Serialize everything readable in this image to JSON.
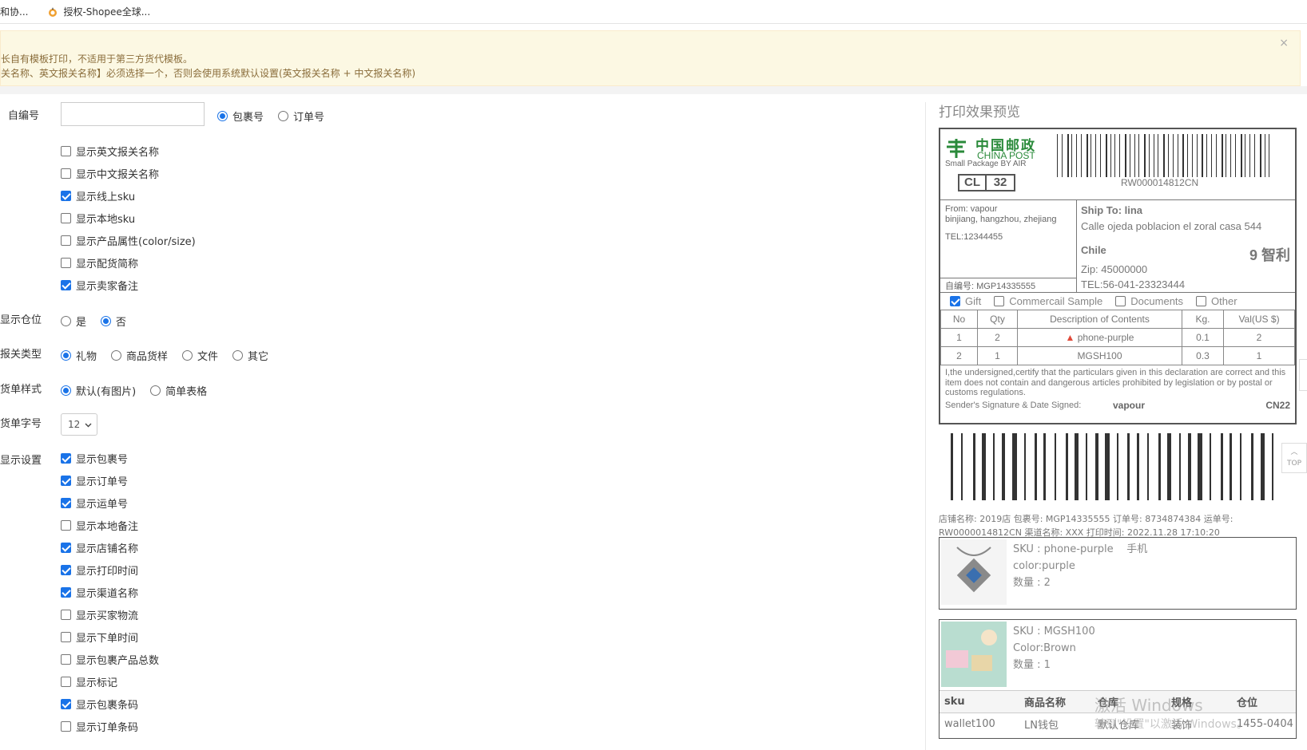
{
  "bookmarks": [
    {
      "label": "和协..."
    },
    {
      "label": "授权-Shopee全球..."
    }
  ],
  "notice": {
    "line1": "长自有模板打印，不适用于第三方货代模板。",
    "line2": "关名称、英文报关名称】必须选择一个，否则会使用系统默认设置(英文报关名称 + 中文报关名称)",
    "close": "×"
  },
  "form": {
    "custom_no_label": "自编号",
    "custom_no_value": "",
    "number_type": {
      "options": [
        "包裹号",
        "订单号"
      ],
      "selected": "包裹号"
    },
    "checks_top": [
      {
        "label": "显示英文报关名称",
        "checked": false
      },
      {
        "label": "显示中文报关名称",
        "checked": false
      },
      {
        "label": "显示线上sku",
        "checked": true
      },
      {
        "label": "显示本地sku",
        "checked": false
      },
      {
        "label": "显示产品属性(color/size)",
        "checked": false
      },
      {
        "label": "显示配货简称",
        "checked": false
      },
      {
        "label": "显示卖家备注",
        "checked": true
      }
    ],
    "show_location": {
      "label": "显示仓位",
      "options": [
        "是",
        "否"
      ],
      "selected": "否"
    },
    "declare_type": {
      "label": "报关类型",
      "options": [
        "礼物",
        "商品货样",
        "文件",
        "其它"
      ],
      "selected": "礼物"
    },
    "bill_style": {
      "label": "货单样式",
      "options": [
        "默认(有图片)",
        "简单表格"
      ],
      "selected": "默认(有图片)"
    },
    "font_size": {
      "label": "货单字号",
      "value": "12"
    },
    "display_settings_label": "显示设置",
    "checks_bottom": [
      {
        "label": "显示包裹号",
        "checked": true
      },
      {
        "label": "显示订单号",
        "checked": true
      },
      {
        "label": "显示运单号",
        "checked": true
      },
      {
        "label": "显示本地备注",
        "checked": false
      },
      {
        "label": "显示店铺名称",
        "checked": true
      },
      {
        "label": "显示打印时间",
        "checked": true
      },
      {
        "label": "显示渠道名称",
        "checked": true
      },
      {
        "label": "显示买家物流",
        "checked": false
      },
      {
        "label": "显示下单时间",
        "checked": false
      },
      {
        "label": "显示包裹产品总数",
        "checked": false
      },
      {
        "label": "显示标记",
        "checked": false
      },
      {
        "label": "显示包裹条码",
        "checked": true
      },
      {
        "label": "显示订单条码",
        "checked": false
      }
    ]
  },
  "preview": {
    "title": "打印效果预览",
    "logo_cn": "中国邮政",
    "logo_en": "CHINA POST",
    "service": "Small Package BY AIR",
    "cl_code": "CL",
    "cl_num": "32",
    "tracking": "RW000014812CN",
    "from_line1": "From: vapour",
    "from_line2": "binjiang, hangzhou, zhejiang",
    "from_tel": "TEL:12344455",
    "ship_to": "Ship To: lina",
    "address": "Calle ojeda poblacion el zoral casa 544",
    "country": "Chile",
    "country_code": "9 智利",
    "zip": "Zip: 45000000",
    "tel": "TEL:56-041-23323444",
    "custom_no": "自编号: MGP14335555",
    "categories": [
      {
        "label": "Gift",
        "checked": true
      },
      {
        "label": "Commercail Sample",
        "checked": false
      },
      {
        "label": "Documents",
        "checked": false
      },
      {
        "label": "Other",
        "checked": false
      }
    ],
    "table_headers": [
      "No",
      "Qty",
      "Description of Contents",
      "Kg.",
      "Val(US $)"
    ],
    "table_rows": [
      {
        "no": "1",
        "qty": "2",
        "desc": "phone-purple",
        "kg": "0.1",
        "val": "2"
      },
      {
        "no": "2",
        "qty": "1",
        "desc": "MGSH100",
        "kg": "0.3",
        "val": "1"
      }
    ],
    "certify": "I,the undersigned,certify that the particulars given in this declaration are correct and this item does not contain and dangerous articles prohibited by legislation or by postal or customs regulations.",
    "signature_label": "Sender's Signature & Date Signed:",
    "signature": "vapour",
    "cn22": "CN22",
    "info_line1": "店铺名称: 2019店    包裹号: MGP14335555    订单号: 8734874384    运单号:",
    "info_line2": "RW0000014812CN    渠道名称: XXX    打印时间: 2022.11.28 17:10:20",
    "sku1": {
      "sku": "SKU : phone-purple",
      "extra": "手机",
      "attr": "color:purple",
      "qty": "数量 : 2"
    },
    "sku2": {
      "sku": "SKU : MGSH100",
      "attr": "Color:Brown",
      "qty": "数量 : 1"
    },
    "mini_headers": [
      "sku",
      "商品名称",
      "仓库",
      "规格",
      "仓位"
    ],
    "mini_row": [
      "wallet100",
      "LN钱包",
      "默认仓库",
      "装饰",
      "1455-0404"
    ]
  },
  "watermark": {
    "line1": "激活 Windows",
    "line2": "转到\"设置\"以激活 Windows。"
  },
  "side": {
    "top_label": "TOP"
  }
}
